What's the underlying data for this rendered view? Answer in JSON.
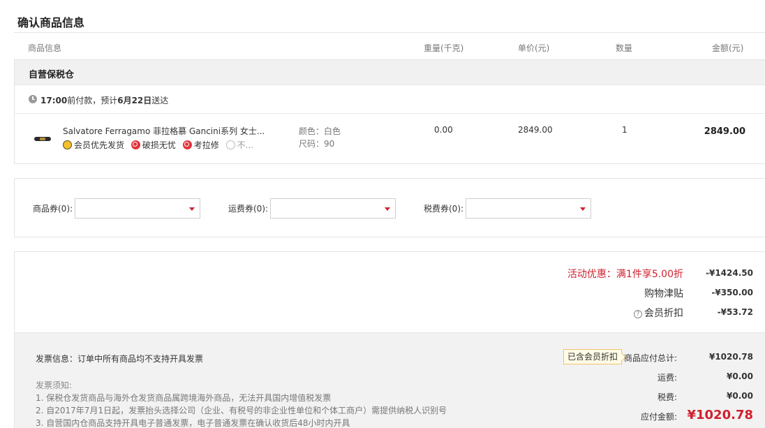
{
  "page_title": "确认商品信息",
  "columns": {
    "product_info": "商品信息",
    "weight": "重量(千克)",
    "unit_price": "单价(元)",
    "quantity": "数量",
    "amount": "金额(元)"
  },
  "store": {
    "name": "自营保税仓",
    "delivery_time": "17:00",
    "delivery_text": "前付款，预计",
    "delivery_date": "6月22日",
    "delivery_suffix": "送达"
  },
  "product": {
    "name": "Salvatore Ferragamo 菲拉格慕 Gancini系列 女士...",
    "badges": {
      "member_priority": "会员优先发货",
      "damage_free": "破损无忧",
      "repair": "考拉修",
      "more": "不..."
    },
    "color_label": "颜色：",
    "color_value": "白色",
    "size_label": "尺码：",
    "size_value": "90",
    "weight": "0.00",
    "unit_price": "2849.00",
    "quantity": "1",
    "amount": "2849.00"
  },
  "coupons": {
    "goods_label": "商品券(0):",
    "shipping_label": "运费券(0):",
    "tax_label": "税费券(0):"
  },
  "discounts": {
    "activity_label": "活动优惠：满1件享5.00折",
    "activity_value": "-¥1424.50",
    "shopping_allowance_label": "购物津贴",
    "shopping_allowance_value": "-¥350.00",
    "member_discount_label": "会员折扣",
    "member_discount_value": "-¥53.72"
  },
  "invoice": {
    "info": "发票信息：订单中所有商品均不支持开具发票",
    "notice_title": "发票须知:",
    "notices": [
      "1. 保税仓发货商品与海外仓发货商品属跨境海外商品，无法开具国内增值税发票",
      "2. 自2017年7月1日起，发票抬头选择公司（企业、有税号的非企业性单位和个体工商户）需提供纳税人识别号",
      "3. 自营国内仓商品支持开具电子普通发票，电子普通发票在确认收货后48小时内开具"
    ]
  },
  "totals": {
    "member_tag": "已含会员折扣",
    "goods_total_label": "商品应付总计:",
    "goods_total_value": "¥1020.78",
    "shipping_label": "运费:",
    "shipping_value": "¥0.00",
    "tax_label": "税费:",
    "tax_value": "¥0.00",
    "payable_label": "应付金额:",
    "payable_value": "¥1020.78"
  },
  "colors": {
    "accent_red": "#d0202e",
    "badge_gold": "#f3c12e"
  }
}
